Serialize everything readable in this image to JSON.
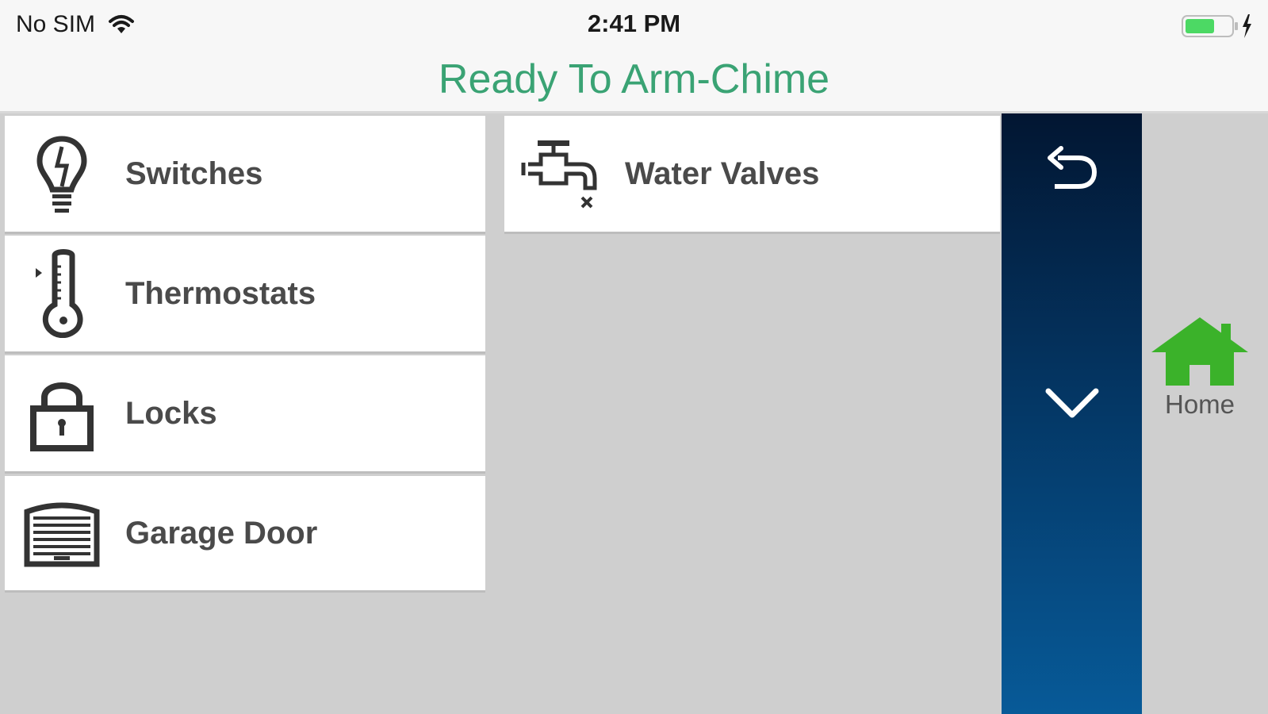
{
  "status_bar": {
    "carrier": "No SIM",
    "time": "2:41 PM",
    "wifi_icon": "wifi-icon",
    "battery_icon": "battery-charging-icon",
    "battery_level": 0.6
  },
  "header": {
    "title": "Ready To Arm-Chime",
    "title_color": "#3aa374"
  },
  "tiles": [
    {
      "label": "Switches",
      "icon": "lightbulb-icon"
    },
    {
      "label": "Thermostats",
      "icon": "thermometer-icon"
    },
    {
      "label": "Locks",
      "icon": "lock-icon"
    },
    {
      "label": "Garage Door",
      "icon": "garage-door-icon"
    },
    {
      "label": "Water Valves",
      "icon": "water-valve-icon"
    }
  ],
  "nav": {
    "back_icon": "back-arrow-icon",
    "down_icon": "chevron-down-icon"
  },
  "home": {
    "label": "Home",
    "icon": "home-icon",
    "color": "#3bb22a"
  }
}
